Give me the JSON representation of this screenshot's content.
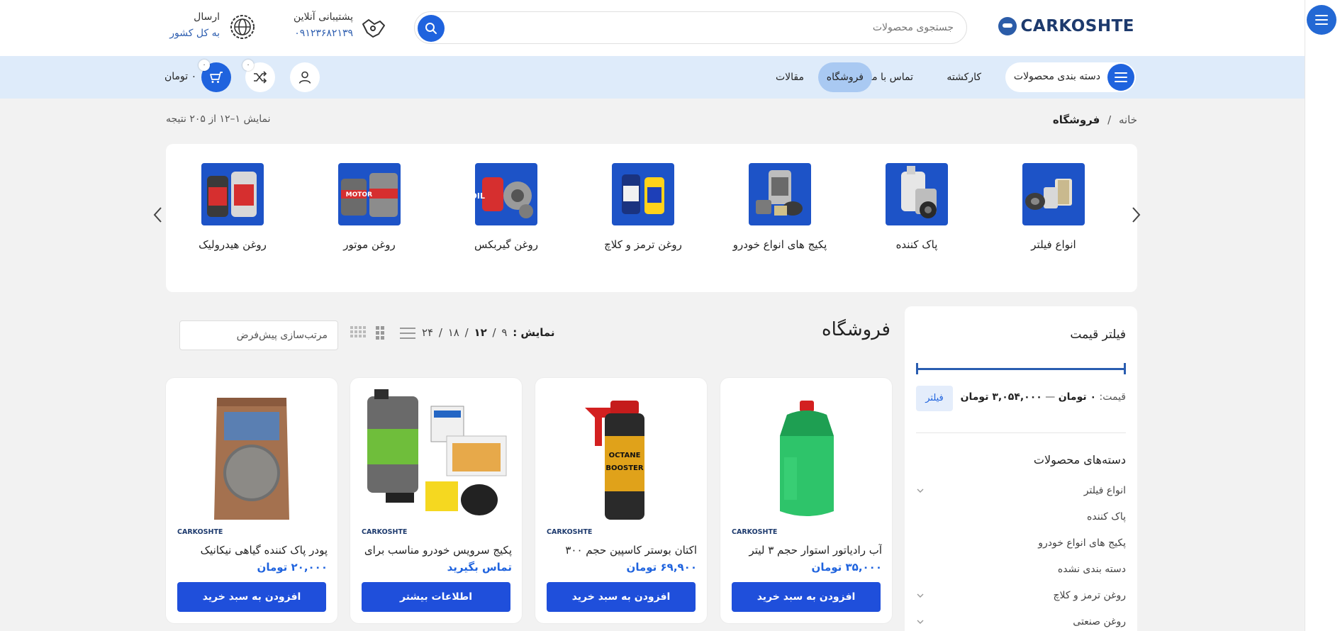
{
  "header": {
    "logo_text": "CARKOSHTE",
    "search_placeholder": "جستجوی محصولات",
    "support_title": "پشتیبانی آنلاین",
    "support_phone": "۰۹۱۲۳۶۸۲۱۳۹",
    "shipping_title": "ارسال",
    "shipping_sub": "به کل کشور"
  },
  "nav": {
    "categories_label": "دسته بندی محصولات",
    "items": [
      "کارکشته",
      "تماس با ما",
      "فروشگاه",
      "مقالات"
    ],
    "active_item": "فروشگاه",
    "compare_count": "۰",
    "cart_count": "۰",
    "cart_total": "۰ تومان"
  },
  "breadcrumb": {
    "home": "خانه",
    "separator": "/",
    "current": "فروشگاه"
  },
  "result_count": "نمایش ۱–۱۲ از ۲۰۵ نتیجه",
  "categories": [
    {
      "label": "انواع فیلتر",
      "icon": "filters-image"
    },
    {
      "label": "پاک کننده",
      "icon": "cleaner-image"
    },
    {
      "label": "پکیج های انواع خودرو",
      "icon": "car-package-image"
    },
    {
      "label": "روغن ترمز و کلاچ",
      "icon": "brake-oil-image"
    },
    {
      "label": "روغن گیربکس",
      "icon": "gearbox-oil-image"
    },
    {
      "label": "روغن موتور",
      "icon": "motor-oil-image"
    },
    {
      "label": "روغن هیدرولیک",
      "icon": "hydraulic-oil-image"
    }
  ],
  "sidebar": {
    "price_filter_title": "فیلتر قیمت",
    "price_prefix": "قیمت:",
    "price_min": "۰ تومان",
    "price_dash": "—",
    "price_max": "۳,۰۵۴,۰۰۰ تومان",
    "filter_button": "فیلتر",
    "categories_title": "دسته‌های محصولات",
    "category_list": [
      {
        "label": "انواع فیلتر",
        "expandable": true
      },
      {
        "label": "پاک کننده",
        "expandable": false
      },
      {
        "label": "پکیج های انواع خودرو",
        "expandable": false
      },
      {
        "label": "دسته بندی نشده",
        "expandable": false
      },
      {
        "label": "روغن ترمز و کلاچ",
        "expandable": true
      },
      {
        "label": "روغن صنعتی",
        "expandable": true
      }
    ]
  },
  "shop": {
    "title": "فروشگاه",
    "per_page_label": "نمایش :",
    "per_page_options": [
      "۹",
      "۱۲",
      "۱۸",
      "۲۴"
    ],
    "per_page_selected": "۱۲",
    "sort_label": "مرتب‌سازی پیش‌فرض"
  },
  "products": [
    {
      "brand": "CARKOSHTE",
      "name": "آب رادیاتور استوار حجم ۳ لیتر",
      "price": "۳۵,۰۰۰ تومان",
      "button": "افزودن به سبد خرید",
      "image": "radiator-water-bottle"
    },
    {
      "brand": "CARKOSHTE",
      "name": "اکتان بوستر کاسپین حجم ۳۰۰",
      "price": "۶۹,۹۰۰ تومان",
      "button": "افزودن به سبد خرید",
      "image": "octane-booster-can"
    },
    {
      "brand": "CARKOSHTE",
      "name": "پکیج سرویس خودرو مناسب برای",
      "price": "تماس بگیرید",
      "button": "اطلاعات بیشتر",
      "image": "service-package"
    },
    {
      "brand": "CARKOSHTE",
      "name": "پودر پاک کننده گیاهی نیکانیک",
      "price": "۲۰,۰۰۰ تومان",
      "button": "افزودن به سبد خرید",
      "image": "cleaner-powder-bag"
    }
  ],
  "colors": {
    "primary": "#1f63de",
    "nav_bg": "#deebfa",
    "active_nav": "#a9c9f2",
    "brand_dark": "#1d3a6d"
  }
}
